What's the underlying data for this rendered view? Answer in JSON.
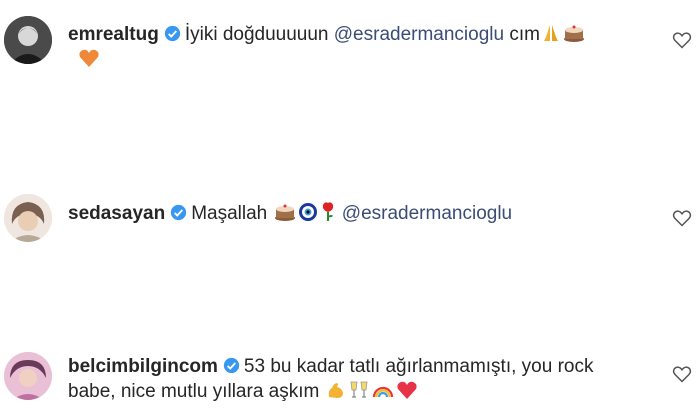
{
  "comments": [
    {
      "username": "emrealtug",
      "text_before": "İyiki doğduuuuun",
      "mention": "@esradermancioglu",
      "text_after": "cım",
      "emojis": [
        "praying-hands-emoji",
        "cake-emoji",
        "orange-heart-emoji"
      ]
    },
    {
      "username": "sedasayan",
      "text_before": "Maşallah",
      "mention": "@esradermancioglu",
      "text_after": "",
      "emojis": [
        "cake-emoji",
        "evil-eye-emoji",
        "rose-emoji"
      ]
    },
    {
      "username": "belcimbilgincom",
      "text_line1": "53 bu kadar tatlı ağırlanmamıştı, you rock",
      "text_line2": "babe, nice mutlu yıllara aşkım",
      "emojis": [
        "flexed-biceps-emoji",
        "clinking-glasses-emoji",
        "rainbow-emoji",
        "red-heart-emoji"
      ]
    }
  ],
  "colors": {
    "text": "#262626",
    "mention": "#3b4d74",
    "verified": "#3897f0"
  },
  "icons": {
    "like": "heart-outline-icon",
    "verified": "verified-badge-icon"
  }
}
